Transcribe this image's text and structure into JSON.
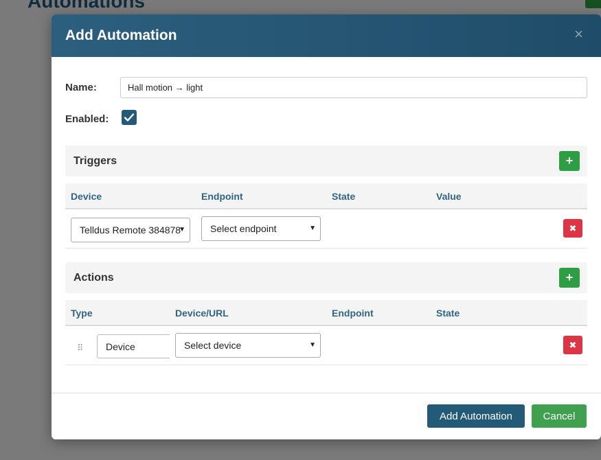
{
  "background": {
    "title": "Automations"
  },
  "modal": {
    "title": "Add Automation",
    "close_icon": "×",
    "name_label": "Name:",
    "name_value": "Hall motion → light",
    "enabled_label": "Enabled:",
    "enabled_checked": true
  },
  "triggers": {
    "title": "Triggers",
    "add_icon": "+",
    "columns": [
      "Device",
      "Endpoint",
      "State",
      "Value"
    ],
    "rows": [
      {
        "device": "Telldus Remote 384878",
        "endpoint": "Select endpoint",
        "delete_icon": "✖"
      }
    ]
  },
  "actions": {
    "title": "Actions",
    "add_icon": "+",
    "columns": [
      "Type",
      "Device/URL",
      "Endpoint",
      "State"
    ],
    "rows": [
      {
        "drag_icon": "⠿",
        "type": "Device",
        "device": "Select device",
        "delete_icon": "✖"
      }
    ]
  },
  "footer": {
    "submit_label": "Add Automation",
    "cancel_label": "Cancel"
  },
  "colors": {
    "header": "#235a77",
    "success": "#2e9e45",
    "danger": "#dc3545",
    "column_header_text": "#2f6584"
  }
}
